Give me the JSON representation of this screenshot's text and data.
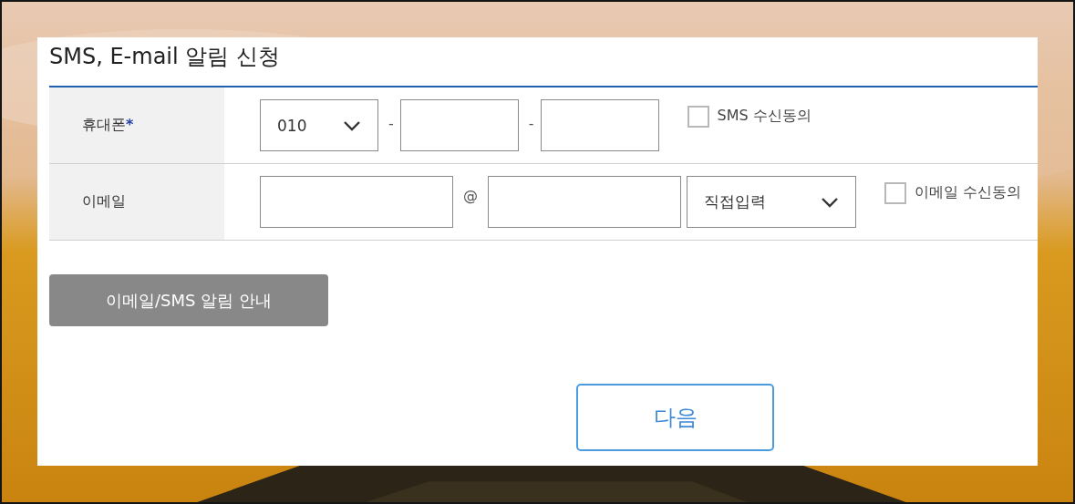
{
  "title": "SMS, E-mail 알림 신청",
  "rows": [
    {
      "label": "휴대폰",
      "required_mark": "*",
      "fields": [
        {
          "kind": "select",
          "value": "010"
        },
        {
          "kind": "separator",
          "text": "-"
        },
        {
          "kind": "input"
        },
        {
          "kind": "separator",
          "text": "-"
        },
        {
          "kind": "input"
        }
      ],
      "consent": {
        "label": "SMS 수신동의",
        "checked": false
      }
    },
    {
      "label": "이메일",
      "fields": [
        {
          "kind": "input"
        },
        {
          "kind": "separator",
          "text": "@"
        },
        {
          "kind": "input"
        },
        {
          "kind": "select",
          "value": "직접입력"
        }
      ],
      "consent": {
        "label": "이메일 수신동의",
        "checked": false
      }
    }
  ],
  "info_button": "이메일/SMS 알림 안내",
  "next_button": "다음"
}
